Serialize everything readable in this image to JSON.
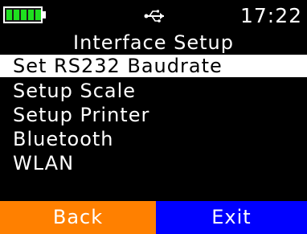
{
  "status_bar": {
    "battery_icon": "battery-full-icon",
    "battery_level": 1.0,
    "battery_color": "#1fe01f",
    "connection_icon": "usb-icon",
    "time": "17:22"
  },
  "screen": {
    "title": "Interface Setup"
  },
  "menu": {
    "items": [
      {
        "label": "Set RS232 Baudrate",
        "selected": true
      },
      {
        "label": "Setup Scale",
        "selected": false
      },
      {
        "label": "Setup Printer",
        "selected": false
      },
      {
        "label": "Bluetooth",
        "selected": false
      },
      {
        "label": "WLAN",
        "selected": false
      }
    ]
  },
  "softkeys": {
    "left_label": "Back",
    "left_color": "#ff8000",
    "right_label": "Exit",
    "right_color": "#0000ff"
  }
}
